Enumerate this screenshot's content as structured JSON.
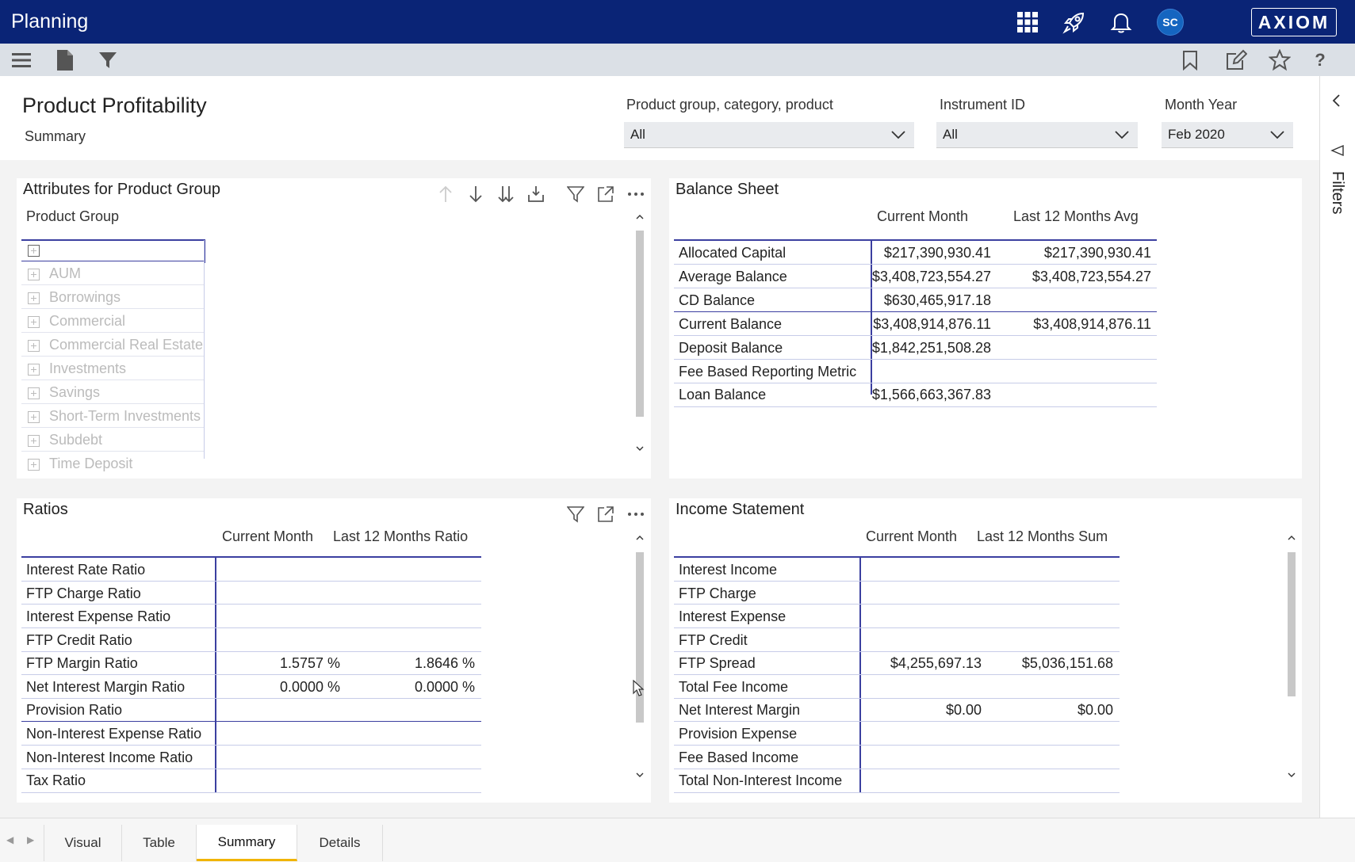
{
  "app": {
    "title": "Planning",
    "avatar_initials": "SC",
    "logo": "AXIOM"
  },
  "topbar_icons": [
    "apps-grid-icon",
    "rocket-icon",
    "bell-icon"
  ],
  "toolbar_icons": [
    "menu-icon",
    "document-icon",
    "filter-icon",
    "bookmark-icon",
    "edit-icon",
    "star-icon",
    "help-icon"
  ],
  "page": {
    "title": "Product Profitability",
    "subtitle": "Summary"
  },
  "filters": [
    {
      "label": "Product group, category, product",
      "value": "All"
    },
    {
      "label": "Instrument ID",
      "value": "All"
    },
    {
      "label": "Month Year",
      "value": "Feb 2020"
    }
  ],
  "attributes_panel": {
    "title": "Attributes for Product Group",
    "column": "Product Group",
    "items": [
      "",
      "AUM",
      "Borrowings",
      "Commercial",
      "Commercial Real Estate",
      "Investments",
      "Savings",
      "Short-Term Investments",
      "Subdebt",
      "Time Deposit"
    ]
  },
  "balance_sheet": {
    "title": "Balance Sheet",
    "columns": [
      "Current Month",
      "Last 12 Months Avg"
    ],
    "rows": [
      {
        "label": "Allocated Capital",
        "values": [
          "$217,390,930.41",
          "$217,390,930.41"
        ]
      },
      {
        "label": "Average Balance",
        "values": [
          "$3,408,723,554.27",
          "$3,408,723,554.27"
        ]
      },
      {
        "label": "CD Balance",
        "values": [
          "$630,465,917.18",
          ""
        ]
      },
      {
        "label": "Current Balance",
        "values": [
          "$3,408,914,876.11",
          "$3,408,914,876.11"
        ]
      },
      {
        "label": "Deposit Balance",
        "values": [
          "$1,842,251,508.28",
          ""
        ]
      },
      {
        "label": "Fee Based Reporting Metric",
        "values": [
          "",
          ""
        ]
      },
      {
        "label": "Loan Balance",
        "values": [
          "$1,566,663,367.83",
          ""
        ]
      }
    ]
  },
  "ratios": {
    "title": "Ratios",
    "columns": [
      "Current Month",
      "Last 12 Months Ratio"
    ],
    "rows": [
      {
        "label": "Interest Rate Ratio",
        "values": [
          "",
          ""
        ]
      },
      {
        "label": "FTP Charge Ratio",
        "values": [
          "",
          ""
        ]
      },
      {
        "label": "Interest Expense Ratio",
        "values": [
          "",
          ""
        ]
      },
      {
        "label": "FTP Credit Ratio",
        "values": [
          "",
          ""
        ]
      },
      {
        "label": "FTP Margin Ratio",
        "values": [
          "1.5757 %",
          "1.8646 %"
        ]
      },
      {
        "label": "Net Interest Margin Ratio",
        "values": [
          "0.0000 %",
          "0.0000 %"
        ]
      },
      {
        "label": "Provision Ratio",
        "values": [
          "",
          ""
        ]
      },
      {
        "label": "Non-Interest Expense Ratio",
        "values": [
          "",
          ""
        ]
      },
      {
        "label": "Non-Interest Income Ratio",
        "values": [
          "",
          ""
        ]
      },
      {
        "label": "Tax Ratio",
        "values": [
          "",
          ""
        ]
      }
    ]
  },
  "income_statement": {
    "title": "Income Statement",
    "columns": [
      "Current Month",
      "Last 12 Months Sum"
    ],
    "rows": [
      {
        "label": "Interest Income",
        "values": [
          "",
          ""
        ]
      },
      {
        "label": "FTP Charge",
        "values": [
          "",
          ""
        ]
      },
      {
        "label": "Interest Expense",
        "values": [
          "",
          ""
        ]
      },
      {
        "label": "FTP Credit",
        "values": [
          "",
          ""
        ]
      },
      {
        "label": "FTP Spread",
        "values": [
          "$4,255,697.13",
          "$5,036,151.68"
        ]
      },
      {
        "label": "Total Fee Income",
        "values": [
          "",
          ""
        ]
      },
      {
        "label": "Net Interest Margin",
        "values": [
          "$0.00",
          "$0.00"
        ]
      },
      {
        "label": "Provision Expense",
        "values": [
          "",
          ""
        ]
      },
      {
        "label": "Fee Based Income",
        "values": [
          "",
          ""
        ]
      },
      {
        "label": "Total Non-Interest Income",
        "values": [
          "",
          ""
        ]
      }
    ]
  },
  "rail": {
    "label": "Filters"
  },
  "tabs": [
    {
      "label": "Visual",
      "active": false
    },
    {
      "label": "Table",
      "active": false
    },
    {
      "label": "Summary",
      "active": true
    },
    {
      "label": "Details",
      "active": false
    }
  ],
  "colors": {
    "header_bg": "#0a2476",
    "accent": "#f0b400",
    "table_rule": "#3b3fa0"
  }
}
